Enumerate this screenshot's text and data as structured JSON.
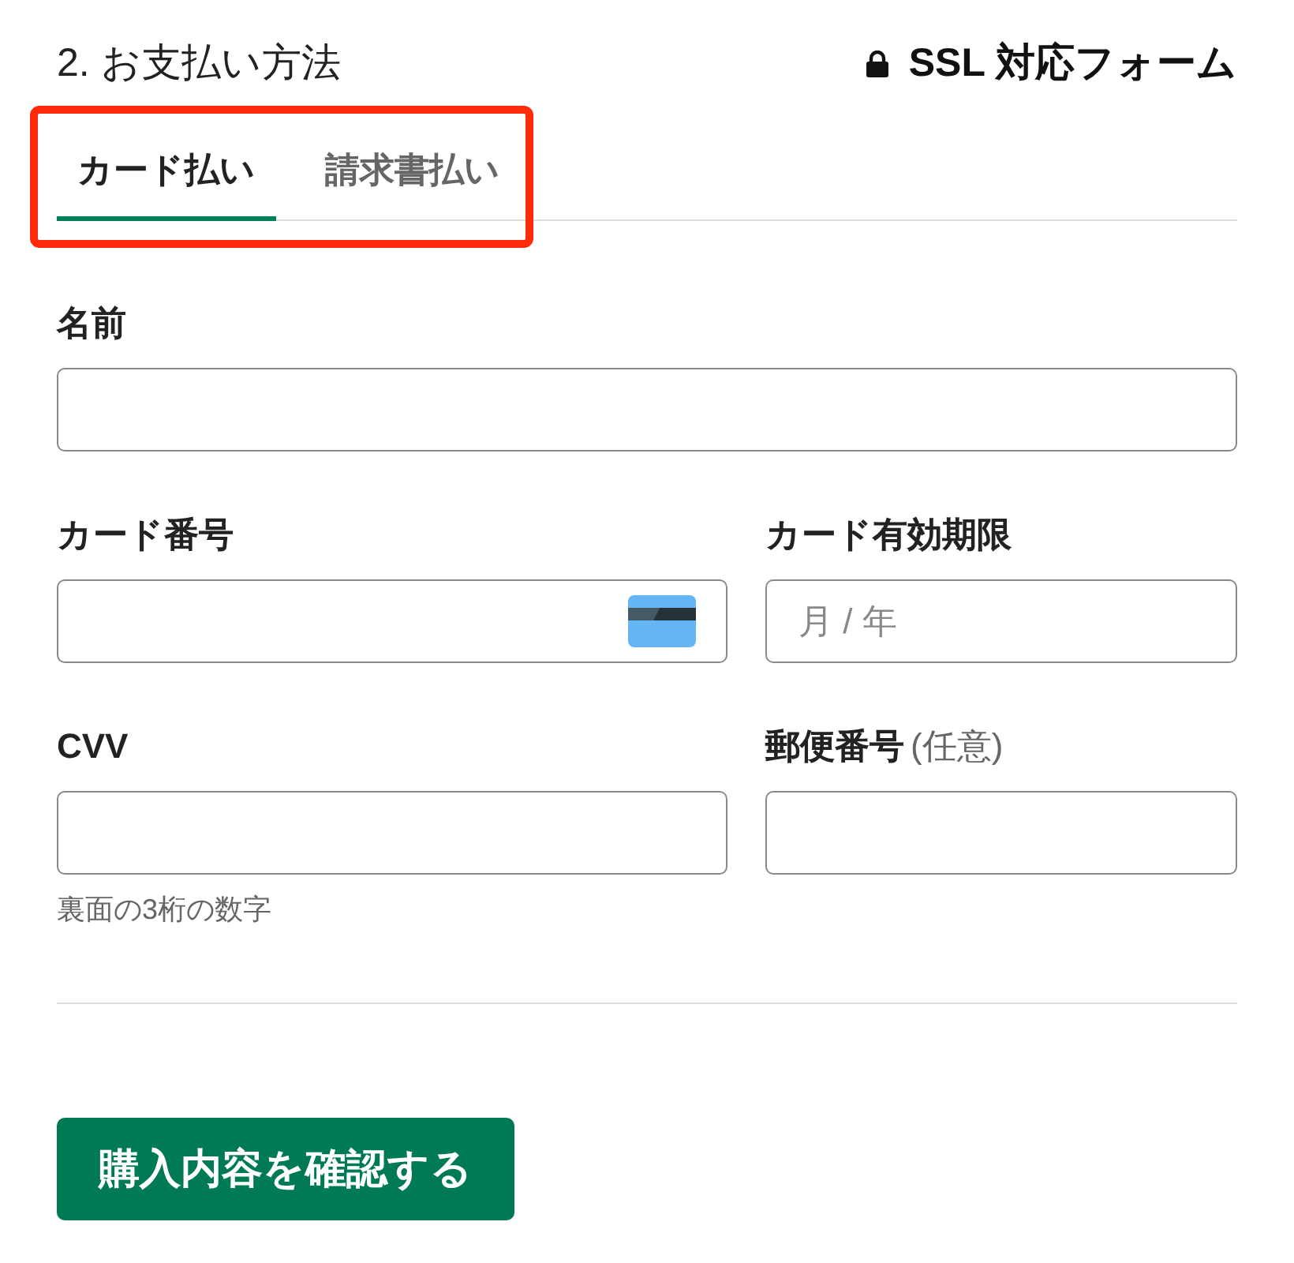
{
  "header": {
    "title": "2. お支払い方法",
    "security_note": "SSL 対応フォーム"
  },
  "tabs": {
    "highlighted": true,
    "items": [
      {
        "label": "カード払い",
        "selected": true
      },
      {
        "label": "請求書払い",
        "selected": false
      }
    ]
  },
  "rows": [
    {
      "fields": [
        {
          "kind": "plain",
          "label": "名前"
        }
      ]
    },
    {
      "fields": [
        {
          "kind": "card",
          "label": "カード番号"
        },
        {
          "kind": "plain",
          "label": "カード有効期限",
          "placeholder": "月 / 年"
        }
      ]
    },
    {
      "fields": [
        {
          "kind": "plain",
          "label": "CVV",
          "hint": "裏面の3桁の数字"
        },
        {
          "kind": "plain",
          "label": "郵便番号",
          "note": "(任意)"
        }
      ]
    }
  ],
  "submit": {
    "label": "購入内容を確認する"
  }
}
